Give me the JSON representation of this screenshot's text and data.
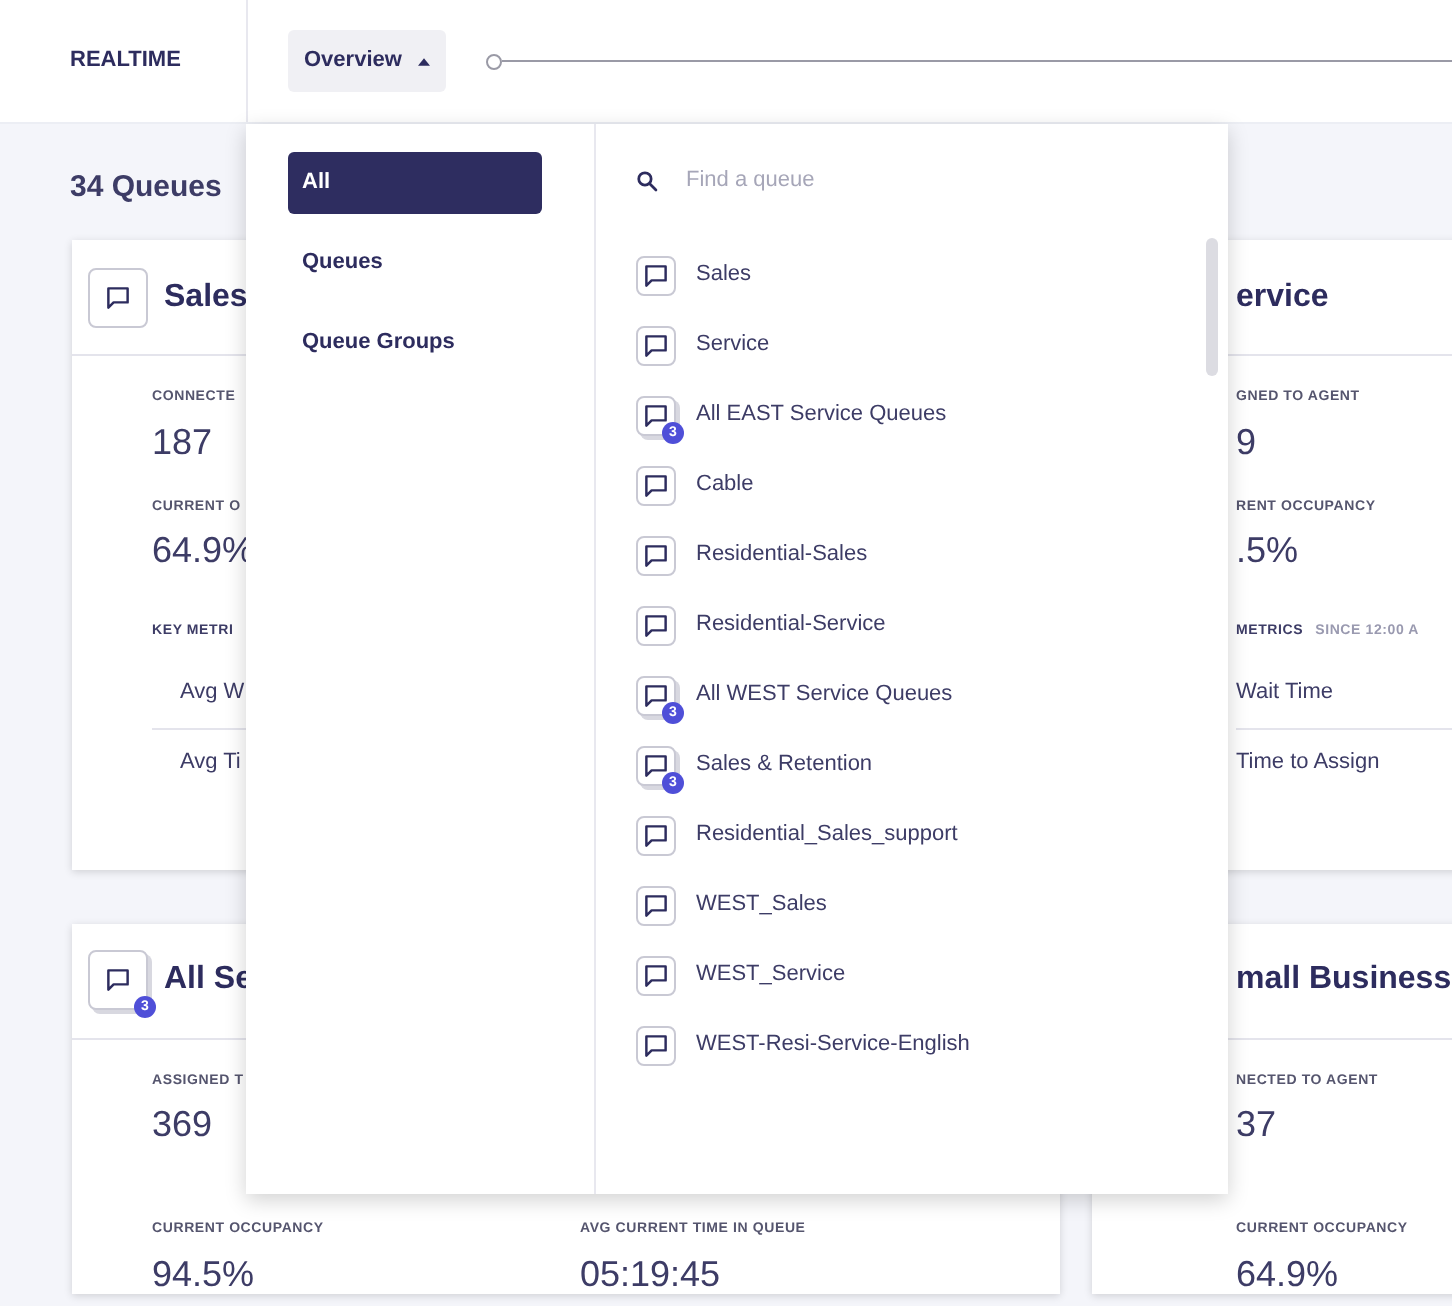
{
  "header": {
    "title": "REALTIME",
    "view_button": {
      "label": "Overview",
      "expanded": true
    },
    "timeline": {
      "level": 0
    }
  },
  "queue_count": "34 Queues",
  "cards": [
    {
      "kind": "queue",
      "title": "Sales",
      "metric_rows": [
        [
          {
            "label": "CONNECTE",
            "value": "187"
          }
        ],
        [
          {
            "label": "CURRENT O",
            "value": "64.9%"
          }
        ]
      ],
      "key_metrics": {
        "label": "KEY METRI",
        "rows": [
          "Avg W",
          "Avg Ti"
        ]
      }
    },
    {
      "title": "ervice",
      "metric_rows": [
        [
          {
            "label": "GNED TO AGENT",
            "value": "9"
          }
        ],
        [
          {
            "label": "RENT OCCUPANCY",
            "value": ".5%"
          }
        ]
      ],
      "key_metrics": {
        "label": "METRICS",
        "since": "SINCE 12:00 A",
        "rows": [
          "Wait Time",
          "Time to Assign"
        ]
      }
    },
    {
      "kind": "group",
      "badge": "3",
      "title": "All Se",
      "metric_rows": [
        [
          {
            "label": "ASSIGNED T",
            "value": "369"
          }
        ],
        [
          {
            "label": "CURRENT OCCUPANCY",
            "value": "94.5%"
          },
          {
            "label": "AVG CURRENT TIME IN QUEUE",
            "value": "05:19:45"
          }
        ]
      ]
    },
    {
      "title": "mall Business",
      "metric_rows": [
        [
          {
            "label": "NECTED TO AGENT",
            "value": "37"
          }
        ],
        [
          {
            "label": "CURRENT OCCUPANCY",
            "value": "64.9%"
          }
        ]
      ]
    }
  ],
  "dropdown": {
    "categories": [
      {
        "label": "All",
        "selected": true
      },
      {
        "label": "Queues",
        "selected": false
      },
      {
        "label": "Queue Groups",
        "selected": false
      }
    ],
    "search": {
      "placeholder": "Find a queue"
    },
    "items": [
      {
        "kind": "queue",
        "label": "Sales"
      },
      {
        "kind": "queue",
        "label": "Service"
      },
      {
        "kind": "group",
        "label": "All EAST Service Queues",
        "badge": "3"
      },
      {
        "kind": "queue",
        "label": "Cable"
      },
      {
        "kind": "queue",
        "label": "Residential-Sales"
      },
      {
        "kind": "queue",
        "label": "Residential-Service"
      },
      {
        "kind": "group",
        "label": "All WEST Service Queues",
        "badge": "3"
      },
      {
        "kind": "group",
        "label": "Sales & Retention",
        "badge": "3"
      },
      {
        "kind": "queue",
        "label": "Residential_Sales_support"
      },
      {
        "kind": "queue",
        "label": "WEST_Sales"
      },
      {
        "kind": "queue",
        "label": "WEST_Service"
      },
      {
        "kind": "queue",
        "label": "WEST-Resi-Service-English"
      }
    ]
  }
}
